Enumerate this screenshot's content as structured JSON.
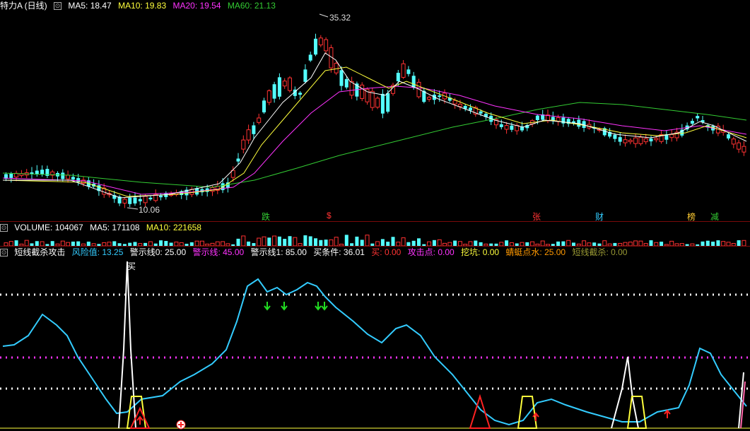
{
  "main": {
    "title": "特力A (日线)",
    "ma": [
      {
        "label": "MA5: 18.47",
        "color": "#ffffff"
      },
      {
        "label": "MA10: 19.83",
        "color": "#ffff3c"
      },
      {
        "label": "MA20: 19.54",
        "color": "#ff33ff"
      },
      {
        "label": "MA60: 21.13",
        "color": "#33cc33"
      }
    ],
    "high_label": "35.32",
    "low_label": "10.06",
    "markers": [
      {
        "text": "跌",
        "color": "#33cc33"
      },
      {
        "text": "$",
        "color": "#ff3333"
      },
      {
        "text": "张",
        "color": "#ff3333"
      },
      {
        "text": "财",
        "color": "#33ccff"
      },
      {
        "text": "榜",
        "color": "#ffcc33"
      },
      {
        "text": "减",
        "color": "#33cc33"
      }
    ]
  },
  "volume": {
    "items": [
      {
        "label": "VOLUME: 104067",
        "color": "#ffffff"
      },
      {
        "label": "MA5: 171108",
        "color": "#ffffff"
      },
      {
        "label": "MA10: 221658",
        "color": "#ffff3c"
      }
    ]
  },
  "indicator": {
    "name": "短线截杀攻击",
    "items": [
      {
        "label": "风险值: 13.25",
        "color": "#33ccff"
      },
      {
        "label": "警示线0: 25.00",
        "color": "#ffffff"
      },
      {
        "label": "警示线: 45.00",
        "color": "#ff33ff"
      },
      {
        "label": "警示线1: 85.00",
        "color": "#ffffff"
      },
      {
        "label": "买条件: 36.01",
        "color": "#ffffff"
      },
      {
        "label": "买: 0.00",
        "color": "#ff3333"
      },
      {
        "label": "攻击点: 0.00",
        "color": "#ff33ff"
      },
      {
        "label": "挖坑: 0.00",
        "color": "#ffff3c"
      },
      {
        "label": "蜻蜓点水: 25.00",
        "color": "#ff9900"
      },
      {
        "label": "短线截杀: 0.00",
        "color": "#999933"
      }
    ],
    "buy_label": "买"
  },
  "colors": {
    "up": "#ff3232",
    "down": "#54ffff",
    "ma5": "#ffffff",
    "ma10": "#ffff3c",
    "ma20": "#ff33ff",
    "ma60": "#33cc33",
    "risk": "#33ccff"
  }
}
